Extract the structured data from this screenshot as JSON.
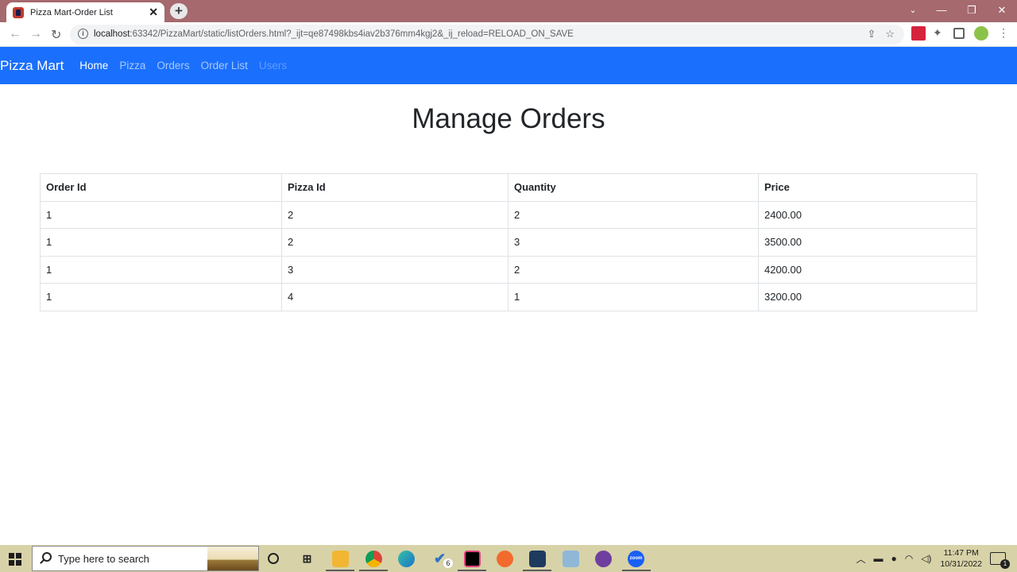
{
  "browser": {
    "tab_title": "Pizza Mart-Order List",
    "url_host": "localhost",
    "url_rest": ":63342/PizzaMart/static/listOrders.html?_ijt=qe87498kbs4iav2b376mm4kgj2&_ij_reload=RELOAD_ON_SAVE"
  },
  "navbar": {
    "brand": "Pizza Mart",
    "links": [
      {
        "label": "Home",
        "state": "active"
      },
      {
        "label": "Pizza",
        "state": "normal"
      },
      {
        "label": "Orders",
        "state": "normal"
      },
      {
        "label": "Order List",
        "state": "normal"
      },
      {
        "label": "Users",
        "state": "disabled"
      }
    ],
    "color": "#1a6ffd"
  },
  "main": {
    "heading": "Manage Orders",
    "table": {
      "headers": [
        "Order Id",
        "Pizza Id",
        "Quantity",
        "Price"
      ],
      "rows": [
        [
          "1",
          "2",
          "2",
          "2400.00"
        ],
        [
          "1",
          "2",
          "3",
          "3500.00"
        ],
        [
          "1",
          "3",
          "2",
          "4200.00"
        ],
        [
          "1",
          "4",
          "1",
          "3200.00"
        ]
      ]
    }
  },
  "taskbar": {
    "search_placeholder": "Type here to search",
    "badge_count": "6",
    "time": "11:47 PM",
    "date": "10/31/2022",
    "notification_count": "1"
  }
}
